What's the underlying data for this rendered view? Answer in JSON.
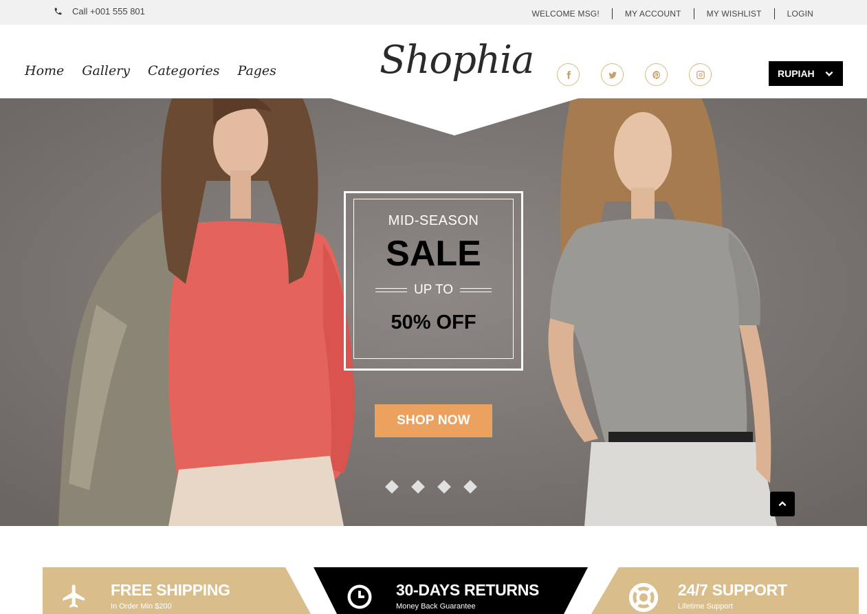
{
  "topbar": {
    "phone": "Call +001 555 801",
    "links": [
      "WELCOME MSG!",
      "MY ACCOUNT",
      "MY WISHLIST",
      "LOGIN"
    ]
  },
  "header": {
    "nav": [
      "Home",
      "Gallery",
      "Categories",
      "Pages"
    ],
    "logo": "Shophia",
    "socials": [
      "facebook-icon",
      "twitter-icon",
      "pinterest-icon",
      "instagram-icon"
    ],
    "currency": "RUPIAH"
  },
  "hero": {
    "promo": {
      "subtitle": "MID-SEASON",
      "headline": "SALE",
      "up_to": "UP TO",
      "discount": "50% OFF"
    },
    "cta": "SHOP NOW",
    "slide_count": 4
  },
  "features": [
    {
      "title": "FREE SHIPPING",
      "desc": "In Order Min $200",
      "icon": "airplane-icon"
    },
    {
      "title": "30-DAYS RETURNS",
      "desc": "Money Back Guarantee",
      "icon": "clock-icon"
    },
    {
      "title": "24/7 SUPPORT",
      "desc": "Lifetime Support",
      "icon": "lifebuoy-icon"
    }
  ],
  "colors": {
    "accent": "#eda15f",
    "tan": "#d9bd8b",
    "hero_bg": "#7a746f",
    "dark": "#000000"
  }
}
